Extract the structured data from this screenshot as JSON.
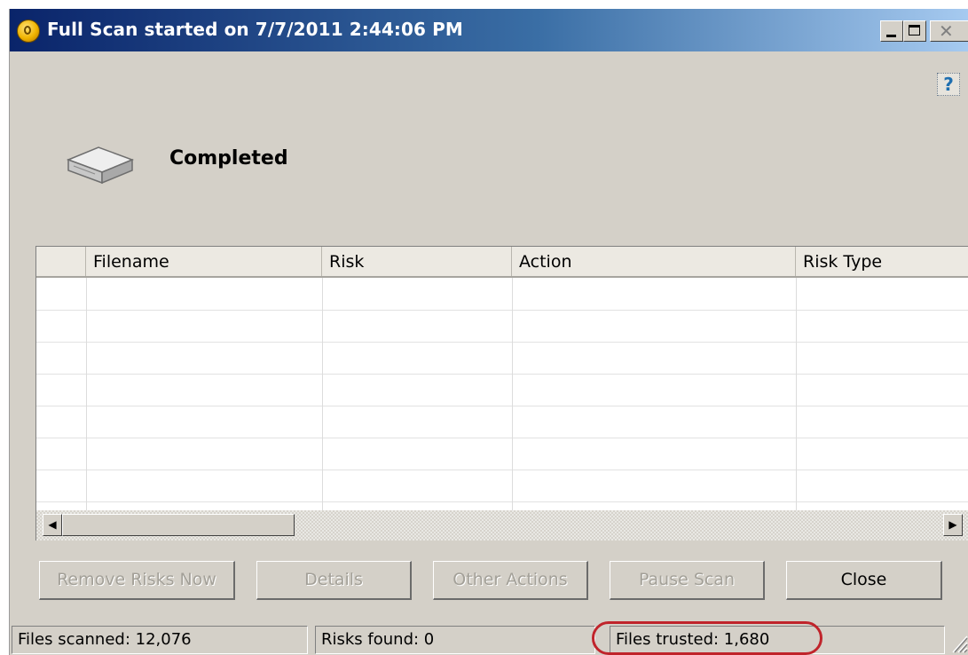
{
  "window": {
    "title": "Full Scan started on 7/7/2011 2:44:06 PM",
    "help_icon": "?"
  },
  "scan": {
    "status": "Completed"
  },
  "table": {
    "columns": [
      "Filename",
      "Risk",
      "Action",
      "Risk Type"
    ],
    "rows": []
  },
  "buttons": {
    "remove_risks": "Remove Risks Now",
    "details": "Details",
    "other_actions": "Other Actions",
    "pause_scan": "Pause Scan",
    "close": "Close"
  },
  "statusbar": {
    "files_scanned": "Files scanned: 12,076",
    "risks_found": "Risks found: 0",
    "files_trusted": "Files trusted: 1,680"
  },
  "colors": {
    "titlebar_start": "#0a246a",
    "titlebar_end": "#a6caf0",
    "window_bg": "#d4d0c8",
    "highlight": "#c0242b"
  },
  "icons": {
    "app": "norton-shield-icon",
    "help": "help-icon",
    "drive": "hard-drive-icon"
  }
}
